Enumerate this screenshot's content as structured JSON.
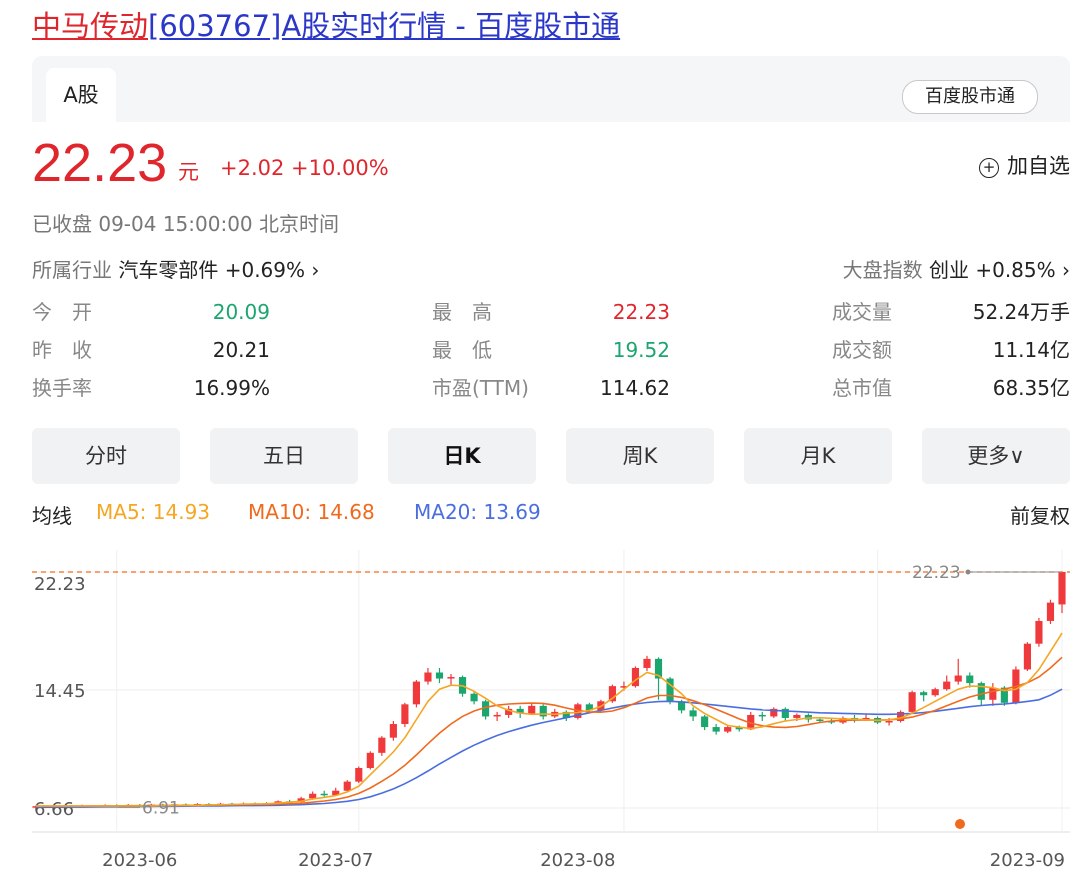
{
  "page_title": {
    "stock_name": "中马传动",
    "rest": "[603767]A股实时行情 - 百度股市通"
  },
  "tabs": {
    "a_share": "A股",
    "source": "百度股市通"
  },
  "quote": {
    "price": "22.23",
    "unit": "元",
    "change": "+2.02 +10.00%",
    "add_watchlist": "加自选",
    "status": "已收盘 09-04 15:00:00 北京时间"
  },
  "industry": {
    "label": "所属行业",
    "value": "汽车零部件 +0.69% ›"
  },
  "index": {
    "label": "大盘指数",
    "value": "创业 +0.85% ›"
  },
  "stats": [
    {
      "label": "今　开",
      "value": "20.09",
      "color": "#1aa66e"
    },
    {
      "label": "最　高",
      "value": "22.23",
      "color": "#e0262d"
    },
    {
      "label": "成交量",
      "value": "52.24万手",
      "color": "#222222"
    },
    {
      "label": "昨　收",
      "value": "20.21",
      "color": "#222222"
    },
    {
      "label": "最　低",
      "value": "19.52",
      "color": "#1aa66e"
    },
    {
      "label": "成交额",
      "value": "11.14亿",
      "color": "#222222"
    },
    {
      "label": "换手率",
      "value": "16.99%",
      "color": "#222222"
    },
    {
      "label": "市盈(TTM)",
      "value": "114.62",
      "color": "#222222"
    },
    {
      "label": "总市值",
      "value": "68.35亿",
      "color": "#222222"
    }
  ],
  "period_tabs": [
    "分时",
    "五日",
    "日K",
    "周K",
    "月K",
    "更多∨"
  ],
  "active_period": "日K",
  "ma": {
    "label": "均线",
    "ma5": "MA5: 14.93",
    "ma10": "MA10: 14.68",
    "ma20": "MA20: 13.69",
    "colors": {
      "ma5": "#f5a623",
      "ma10": "#f06a1e",
      "ma20": "#4a6ee0"
    }
  },
  "adjust": "前复权",
  "chart_data": {
    "type": "candlestick",
    "y_ticks": [
      "22.23",
      "14.45",
      "6.66"
    ],
    "x_ticks": [
      "2023-06",
      "2023-07",
      "2023-08",
      "2023-09"
    ],
    "high_marker": "22.23",
    "low_marker": "6.91",
    "up_color": "#f0393b",
    "down_color": "#1aa66e",
    "candles": [
      [
        6.7,
        6.78,
        6.64,
        6.82
      ],
      [
        6.78,
        6.72,
        6.68,
        6.84
      ],
      [
        6.72,
        6.8,
        6.66,
        6.86
      ],
      [
        6.8,
        6.76,
        6.7,
        6.85
      ],
      [
        6.76,
        6.82,
        6.7,
        6.88
      ],
      [
        6.82,
        6.78,
        6.72,
        6.86
      ],
      [
        6.78,
        6.84,
        6.74,
        6.9
      ],
      [
        6.84,
        6.8,
        6.76,
        6.9
      ],
      [
        6.8,
        6.86,
        6.76,
        6.92
      ],
      [
        6.86,
        6.84,
        6.78,
        6.92
      ],
      [
        6.84,
        6.88,
        6.8,
        6.94
      ],
      [
        6.88,
        6.86,
        6.8,
        6.94
      ],
      [
        6.86,
        6.9,
        6.82,
        6.96
      ],
      [
        6.9,
        6.88,
        6.82,
        6.96
      ],
      [
        6.88,
        6.92,
        6.84,
        6.98
      ],
      [
        6.92,
        6.88,
        6.84,
        6.98
      ],
      [
        6.88,
        6.94,
        6.84,
        7.0
      ],
      [
        6.94,
        6.9,
        6.86,
        7.0
      ],
      [
        6.9,
        6.96,
        6.86,
        7.02
      ],
      [
        6.96,
        6.92,
        6.88,
        7.02
      ],
      [
        6.92,
        6.98,
        6.88,
        7.04
      ],
      [
        6.98,
        7.1,
        6.94,
        7.16
      ],
      [
        7.1,
        7.05,
        7.0,
        7.2
      ],
      [
        7.05,
        7.3,
        7.0,
        7.4
      ],
      [
        7.3,
        7.6,
        7.2,
        7.75
      ],
      [
        7.6,
        7.5,
        7.4,
        7.8
      ],
      [
        7.5,
        7.8,
        7.45,
        8.0
      ],
      [
        7.8,
        8.4,
        7.7,
        8.5
      ],
      [
        8.4,
        9.3,
        8.3,
        9.4
      ],
      [
        9.3,
        10.3,
        9.2,
        10.4
      ],
      [
        10.3,
        11.3,
        10.1,
        11.4
      ],
      [
        11.3,
        12.2,
        11.1,
        12.4
      ],
      [
        12.2,
        13.5,
        12.0,
        13.6
      ],
      [
        13.5,
        15.0,
        13.3,
        15.1
      ],
      [
        15.0,
        15.6,
        14.8,
        15.9
      ],
      [
        15.6,
        15.2,
        14.9,
        15.9
      ],
      [
        15.2,
        15.3,
        14.8,
        15.5
      ],
      [
        15.3,
        14.2,
        14.0,
        15.4
      ],
      [
        14.2,
        13.7,
        13.5,
        14.3
      ],
      [
        13.7,
        12.7,
        12.5,
        13.8
      ],
      [
        12.7,
        12.8,
        12.4,
        13.0
      ],
      [
        12.8,
        13.2,
        12.6,
        13.4
      ],
      [
        13.2,
        12.9,
        12.6,
        13.4
      ],
      [
        12.9,
        13.4,
        12.8,
        13.6
      ],
      [
        13.4,
        12.7,
        12.5,
        13.5
      ],
      [
        12.7,
        13.0,
        12.6,
        13.2
      ],
      [
        13.0,
        12.6,
        12.4,
        13.1
      ],
      [
        12.6,
        13.5,
        12.5,
        13.6
      ],
      [
        13.5,
        13.1,
        12.9,
        13.6
      ],
      [
        13.1,
        13.7,
        13.0,
        13.8
      ],
      [
        13.7,
        14.7,
        13.6,
        14.8
      ],
      [
        14.7,
        14.7,
        14.4,
        15.0
      ],
      [
        14.7,
        15.9,
        14.6,
        16.0
      ],
      [
        15.9,
        16.5,
        15.7,
        16.7
      ],
      [
        16.5,
        15.2,
        13.8,
        16.6
      ],
      [
        15.2,
        13.7,
        13.5,
        15.3
      ],
      [
        13.7,
        13.1,
        12.9,
        13.8
      ],
      [
        13.1,
        12.7,
        12.4,
        13.3
      ],
      [
        12.7,
        12.0,
        11.8,
        12.8
      ],
      [
        12.0,
        11.7,
        11.5,
        12.2
      ],
      [
        11.7,
        12.0,
        11.6,
        12.1
      ],
      [
        12.0,
        11.85,
        11.7,
        12.1
      ],
      [
        11.85,
        12.8,
        11.8,
        13.0
      ],
      [
        12.8,
        12.7,
        12.4,
        13.0
      ],
      [
        12.7,
        13.2,
        12.6,
        13.3
      ],
      [
        13.2,
        12.6,
        12.4,
        13.3
      ],
      [
        12.6,
        12.8,
        12.4,
        12.9
      ],
      [
        12.8,
        12.5,
        12.3,
        12.9
      ],
      [
        12.5,
        12.4,
        12.3,
        12.6
      ],
      [
        12.4,
        12.3,
        12.2,
        12.6
      ],
      [
        12.3,
        12.6,
        12.2,
        12.7
      ],
      [
        12.6,
        12.5,
        12.3,
        12.8
      ],
      [
        12.5,
        12.6,
        12.4,
        12.9
      ],
      [
        12.6,
        12.3,
        12.2,
        12.7
      ],
      [
        12.3,
        12.4,
        12.1,
        12.6
      ],
      [
        12.4,
        13.0,
        12.3,
        13.1
      ],
      [
        13.0,
        14.3,
        12.9,
        14.4
      ],
      [
        14.3,
        14.1,
        13.7,
        14.4
      ],
      [
        14.1,
        14.5,
        14.0,
        14.6
      ],
      [
        14.5,
        15.0,
        14.4,
        15.4
      ],
      [
        15.0,
        15.4,
        14.8,
        16.5
      ],
      [
        15.4,
        14.9,
        14.6,
        15.6
      ],
      [
        14.9,
        13.8,
        13.4,
        15.0
      ],
      [
        13.8,
        14.6,
        13.4,
        14.9
      ],
      [
        14.6,
        13.6,
        13.4,
        14.7
      ],
      [
        13.6,
        15.8,
        13.5,
        16.0
      ],
      [
        15.8,
        17.5,
        15.7,
        17.6
      ],
      [
        17.5,
        19.0,
        17.3,
        19.2
      ],
      [
        19.0,
        20.21,
        18.8,
        20.4
      ],
      [
        20.09,
        22.23,
        19.52,
        22.23
      ]
    ],
    "ma5": [
      6.8,
      6.8,
      6.8,
      6.8,
      6.8,
      6.8,
      6.8,
      6.8,
      6.8,
      6.8,
      6.8,
      6.81,
      6.82,
      6.83,
      6.84,
      6.86,
      6.87,
      6.89,
      6.91,
      6.93,
      6.94,
      6.98,
      7.04,
      7.1,
      7.26,
      7.36,
      7.48,
      7.72,
      8.1,
      8.86,
      9.6,
      10.36,
      11.3,
      12.5,
      13.7,
      14.5,
      14.76,
      14.72,
      14.36,
      13.9,
      13.4,
      13.1,
      12.92,
      12.84,
      12.86,
      12.84,
      12.92,
      12.96,
      13.1,
      13.36,
      13.9,
      14.5,
      15.1,
      15.6,
      15.4,
      14.8,
      14.2,
      13.4,
      12.9,
      12.5,
      12.1,
      12.0,
      11.9,
      12.02,
      12.22,
      12.4,
      12.5,
      12.6,
      12.62,
      12.58,
      12.54,
      12.52,
      12.48,
      12.44,
      12.48,
      12.6,
      12.9,
      13.3,
      13.7,
      14.1,
      14.5,
      14.7,
      14.68,
      14.6,
      14.4,
      14.5,
      14.93,
      15.8,
      17.0,
      18.2
    ],
    "ma10": [
      6.78,
      6.78,
      6.78,
      6.79,
      6.79,
      6.8,
      6.8,
      6.8,
      6.81,
      6.81,
      6.82,
      6.82,
      6.83,
      6.84,
      6.84,
      6.85,
      6.86,
      6.87,
      6.88,
      6.89,
      6.9,
      6.92,
      6.94,
      6.97,
      7.04,
      7.12,
      7.22,
      7.38,
      7.62,
      7.98,
      8.42,
      8.9,
      9.48,
      10.16,
      10.9,
      11.6,
      12.2,
      12.7,
      13.06,
      13.3,
      13.44,
      13.52,
      13.56,
      13.58,
      13.56,
      13.44,
      13.26,
      13.1,
      13.0,
      12.98,
      13.06,
      13.28,
      13.58,
      13.92,
      14.08,
      14.08,
      13.96,
      13.74,
      13.48,
      13.18,
      12.86,
      12.54,
      12.26,
      12.08,
      12.0,
      11.98,
      12.04,
      12.16,
      12.3,
      12.4,
      12.44,
      12.46,
      12.46,
      12.46,
      12.48,
      12.54,
      12.66,
      12.86,
      13.1,
      13.4,
      13.7,
      13.98,
      14.18,
      14.36,
      14.5,
      14.68,
      14.92,
      15.3,
      15.9,
      16.6
    ],
    "ma20": [
      6.7,
      6.71,
      6.71,
      6.72,
      6.72,
      6.73,
      6.74,
      6.74,
      6.75,
      6.75,
      6.76,
      6.77,
      6.77,
      6.78,
      6.79,
      6.8,
      6.8,
      6.81,
      6.82,
      6.82,
      6.83,
      6.84,
      6.86,
      6.88,
      6.92,
      6.96,
      7.02,
      7.1,
      7.22,
      7.4,
      7.64,
      7.92,
      8.26,
      8.66,
      9.1,
      9.56,
      10.0,
      10.42,
      10.8,
      11.14,
      11.44,
      11.7,
      11.92,
      12.12,
      12.3,
      12.46,
      12.62,
      12.78,
      12.94,
      13.1,
      13.26,
      13.4,
      13.52,
      13.62,
      13.68,
      13.7,
      13.66,
      13.6,
      13.52,
      13.44,
      13.36,
      13.28,
      13.2,
      13.14,
      13.1,
      13.06,
      13.02,
      12.98,
      12.94,
      12.92,
      12.9,
      12.88,
      12.86,
      12.84,
      12.84,
      12.86,
      12.9,
      12.96,
      13.04,
      13.14,
      13.24,
      13.34,
      13.42,
      13.48,
      13.52,
      13.6,
      13.69,
      13.8,
      14.1,
      14.5
    ]
  }
}
